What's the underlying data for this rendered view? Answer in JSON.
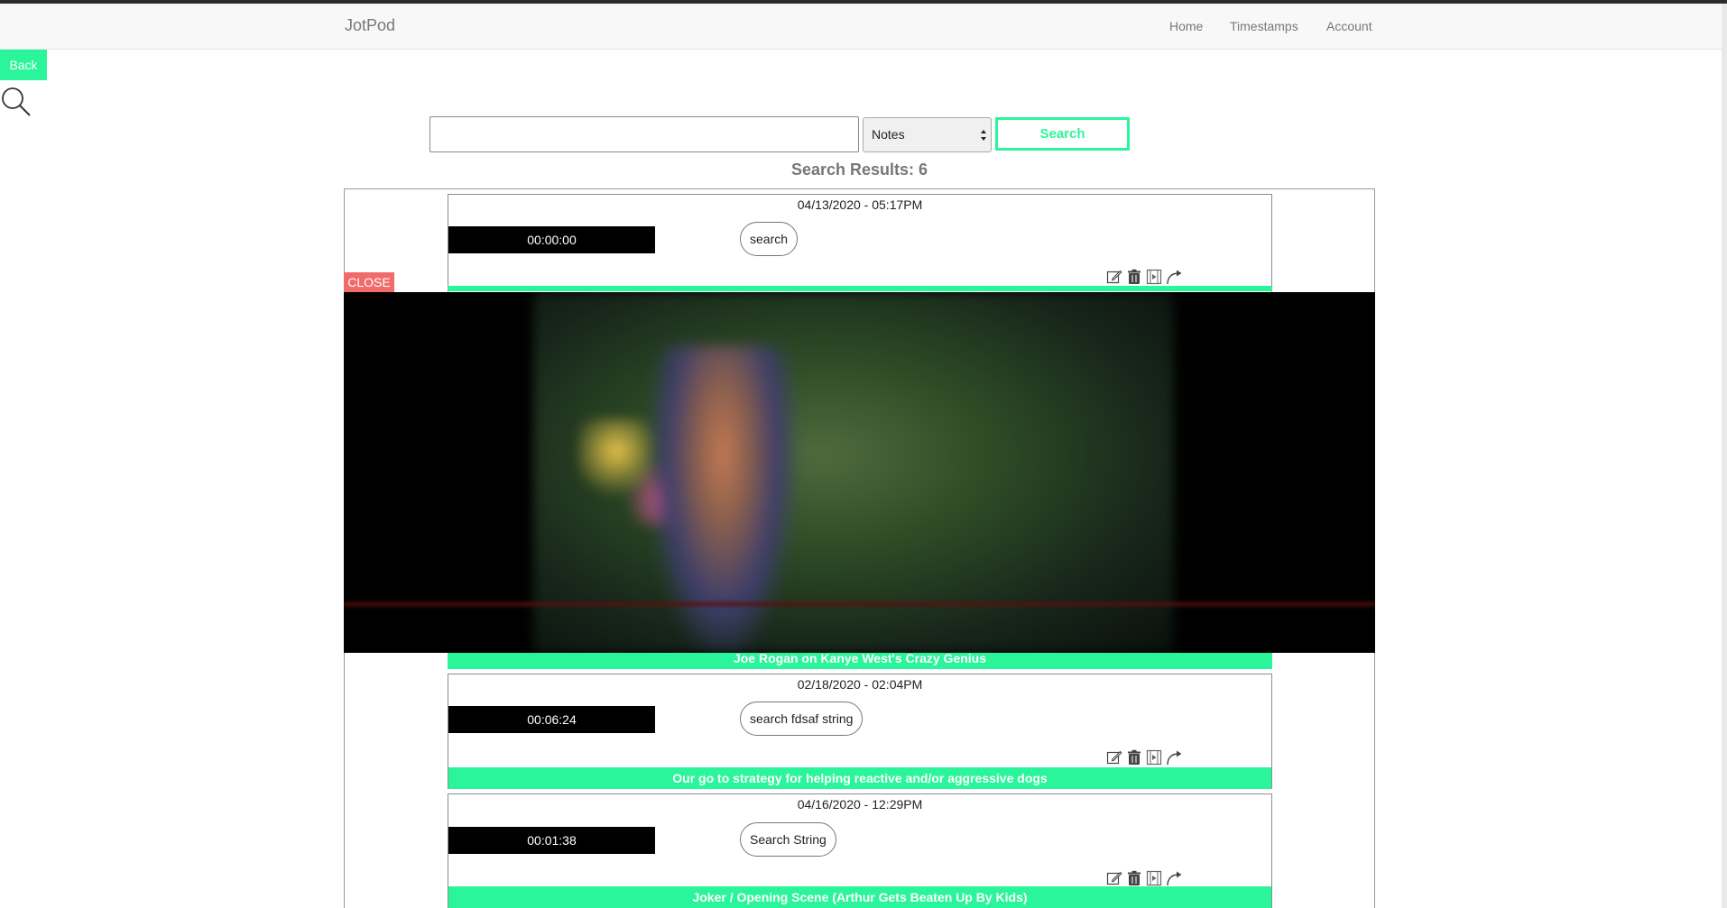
{
  "navbar": {
    "brand": "JotPod",
    "links": [
      "Home",
      "Timestamps",
      "Account"
    ]
  },
  "back_label": "Back",
  "search": {
    "input_value": "",
    "filter_selected": "Notes",
    "button_label": "Search"
  },
  "results_title": "Search Results: 6",
  "close_label": "CLOSE",
  "results": [
    {
      "date": "04/13/2020 - 05:17PM",
      "time": "00:00:00",
      "note": "search",
      "title": "Joe Rogan on Kanye West's Crazy Genius"
    },
    {
      "date": "02/18/2020 - 02:04PM",
      "time": "00:06:24",
      "note": "search fdsaf string",
      "title": "Our go to strategy for helping reactive and/or aggressive dogs"
    },
    {
      "date": "04/16/2020 - 12:29PM",
      "time": "00:01:38",
      "note": "Search String",
      "title": "Joker / Opening Scene (Arthur Gets Beaten Up By Kids)"
    }
  ],
  "icons": {
    "edit": "edit-icon",
    "delete": "trash-icon",
    "video": "video-icon",
    "share": "share-icon"
  },
  "colors": {
    "accent": "#2bf59a",
    "close": "#f26b6b",
    "badge": "#000000"
  }
}
